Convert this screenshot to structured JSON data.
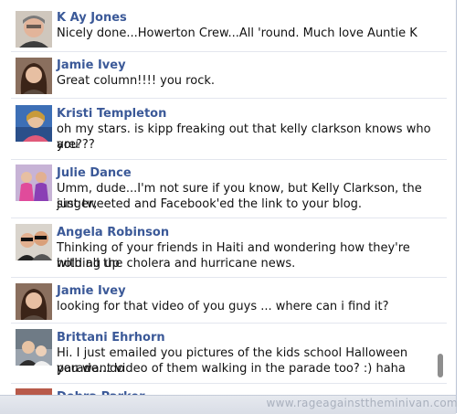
{
  "feed": {
    "comments": [
      {
        "name": "K Ay Jones",
        "lines": [
          "Nicely done...Howerton Crew...All 'round. Much love Auntie K"
        ]
      },
      {
        "name": "Jamie Ivey",
        "lines": [
          "Great column!!!! you rock."
        ]
      },
      {
        "name": "Kristi Templeton",
        "lines": [
          "oh my stars. is kipp freaking out that kelly clarkson knows who you",
          "are???"
        ]
      },
      {
        "name": "Julie Dance",
        "lines": [
          "Umm, dude...I'm not sure if you know, but Kelly Clarkson, the singer,",
          "just tweeted and Facebook'ed the link to your blog."
        ]
      },
      {
        "name": "Angela Robinson",
        "lines": [
          "Thinking of your friends in Haiti and wondering how they're holding up",
          "with all the cholera and hurricane news."
        ]
      },
      {
        "name": "Jamie Ivey",
        "lines": [
          "looking for that video of you guys ... where can i find it?"
        ]
      },
      {
        "name": "Brittani Ehrhorn",
        "lines": [
          "Hi. I just emailed you pictures of the kids school Halloween parade...do",
          "you want video of them walking in the parade too? :) haha"
        ]
      },
      {
        "name": "Debra Parker",
        "lines": []
      }
    ]
  },
  "watermark": "www.rageagainsttheminivan.com",
  "colors": {
    "name_link": "#3b5998",
    "text": "#111111",
    "separator": "#e3e6ee"
  }
}
